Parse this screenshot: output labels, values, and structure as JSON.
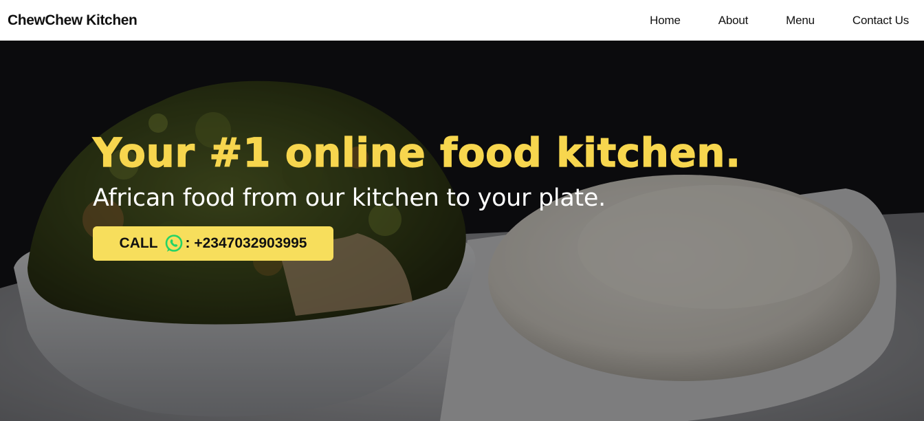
{
  "nav": {
    "brand": "ChewChew Kitchen",
    "links": [
      {
        "label": "Home"
      },
      {
        "label": "About"
      },
      {
        "label": "Menu"
      },
      {
        "label": "Contact Us"
      }
    ]
  },
  "hero": {
    "title": "Your #1 online food kitchen.",
    "subtitle": "African food from our kitchen to your plate.",
    "cta": {
      "prefix": "CALL",
      "icon": "whatsapp-icon",
      "phone": ": +2347032903995"
    },
    "image": "egusi-soup-and-pounded-yam-photo"
  },
  "colors": {
    "accent": "#f7d64e",
    "button": "#f7de5c",
    "whatsapp": "#25d366"
  }
}
